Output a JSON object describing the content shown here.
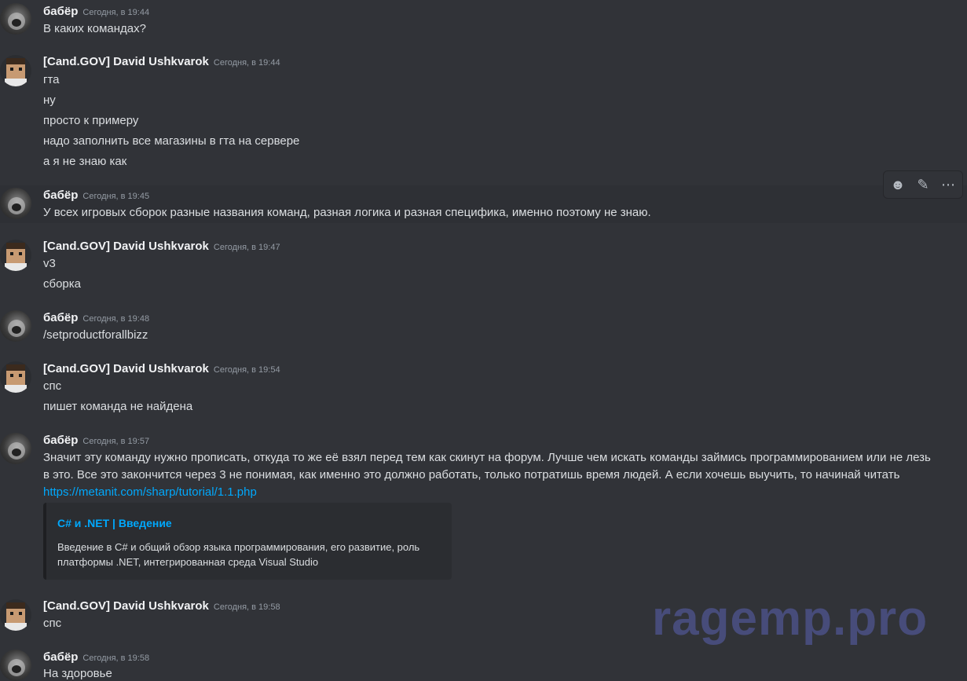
{
  "messages": [
    {
      "author": "бабёр",
      "time": "Сегодня, в 19:44",
      "lines": [
        "В каких командах?"
      ]
    },
    {
      "author": "[Cand.GOV] David Ushkvarok",
      "time": "Сегодня, в 19:44",
      "lines": [
        "гта",
        "ну",
        "просто к примеру",
        "надо заполнить все магазины в гта на сервере",
        "а я не знаю как"
      ]
    },
    {
      "author": "бабёр",
      "time": "Сегодня, в 19:45",
      "lines": [
        "У всех игровых сборок разные названия команд, разная логика и разная специфика, именно поэтому не знаю."
      ]
    },
    {
      "author": "[Cand.GOV] David Ushkvarok",
      "time": "Сегодня, в 19:47",
      "lines": [
        "v3",
        "сборка"
      ]
    },
    {
      "author": "бабёр",
      "time": "Сегодня, в 19:48",
      "lines": [
        "/setproductforallbizz"
      ]
    },
    {
      "author": "[Cand.GOV] David Ushkvarok",
      "time": "Сегодня, в 19:54",
      "lines": [
        "спс",
        "пишет команда не найдена"
      ]
    },
    {
      "author": "бабёр",
      "time": "Сегодня, в 19:57",
      "lines": [
        "Значит эту команду нужно прописать, откуда то же её взял перед тем как скинут на форум. Лучше чем искать команды займись программированием или не лезь",
        "в это. Все это закончится через 3 не понимая, как именно это должно работать, только потратишь время людей. А если хочешь выучить, то начинай читать"
      ],
      "link": "https://metanit.com/sharp/tutorial/1.1.php",
      "embed": {
        "title": "C# и .NET | Введение",
        "description": "Введение в C# и общий обзор языка программирования, его развитие, роль платформы .NET, интегрированная среда Visual Studio"
      }
    },
    {
      "author": "[Cand.GOV] David Ushkvarok",
      "time": "Сегодня, в 19:58",
      "lines": [
        "спс"
      ]
    },
    {
      "author": "бабёр",
      "time": "Сегодня, в 19:58",
      "lines": [
        "На здоровье"
      ]
    }
  ],
  "toolbar": {
    "icons": [
      "emoji-icon",
      "edit-icon",
      "more-icon"
    ]
  },
  "watermark": "ragemp.pro"
}
